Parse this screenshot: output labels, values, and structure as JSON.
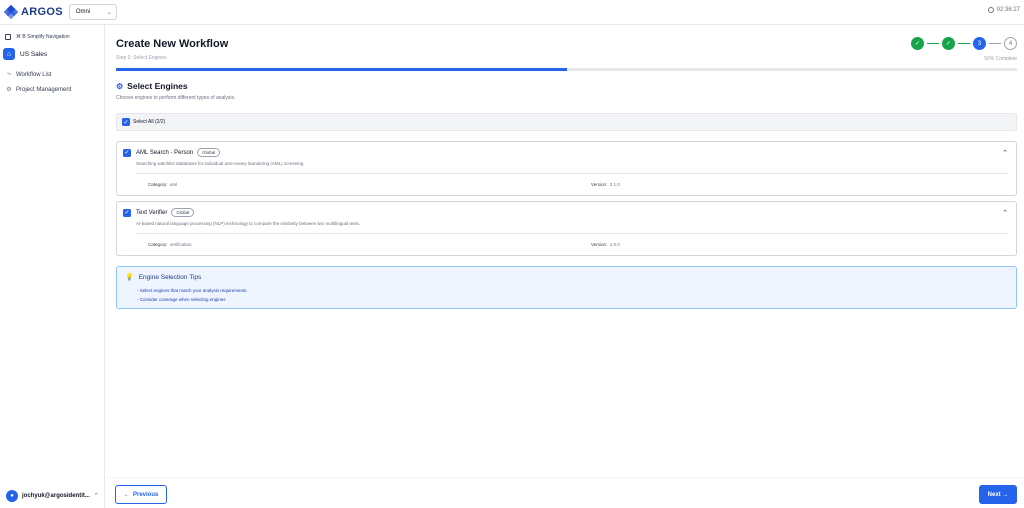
{
  "header": {
    "brand": "ARGOS",
    "tenant_value": "Omni",
    "clock": "02:36:27"
  },
  "sidebar": {
    "simplify_label": "Simplify Navigation",
    "workspace_label": "US Sales",
    "items": [
      {
        "label": "Workflow List",
        "icon": "workflow-icon"
      },
      {
        "label": "Project Management",
        "icon": "gear-icon"
      }
    ],
    "user_label": "jochyuk@argosidentit..."
  },
  "page": {
    "title": "Create New Workflow",
    "subtitle": "Step 3: Select Engines",
    "progress_text": "50% Complete",
    "progress_fraction": 0.5,
    "steps": [
      {
        "label": "✓",
        "state": "done"
      },
      {
        "label": "✓",
        "state": "done"
      },
      {
        "label": "3",
        "state": "current"
      },
      {
        "label": "4",
        "state": "todo"
      }
    ]
  },
  "section": {
    "title": "Select Engines",
    "description": "Choose engines to perform different types of analysis.",
    "select_all_label": "Select All (2/2)"
  },
  "engines": [
    {
      "name": "AML Search - Person",
      "badge": "Global",
      "description": "Searching watchlist databases for individual anti-money laundering (AML) screening",
      "category_label": "Category:",
      "category_value": "aml",
      "version_label": "Version:",
      "version_value": "2.1.0",
      "checked": true
    },
    {
      "name": "Text Verifier",
      "badge": "Global",
      "description": "AI-based natural language processing (NLP) technology to compare the similarity between two multilingual texts.",
      "category_label": "Category:",
      "category_value": "verification",
      "version_label": "Version:",
      "version_value": "1.0.0",
      "checked": true
    }
  ],
  "tips": {
    "title": "Engine Selection Tips",
    "lines": [
      "- Select engines that match your analysis requirements",
      "- Consider coverage when selecting engines"
    ]
  },
  "footer": {
    "previous_label": "Previous",
    "next_label": "Next"
  },
  "colors": {
    "primary": "#2563eb",
    "success": "#16a34a",
    "tips_bg": "#eef5ff"
  }
}
